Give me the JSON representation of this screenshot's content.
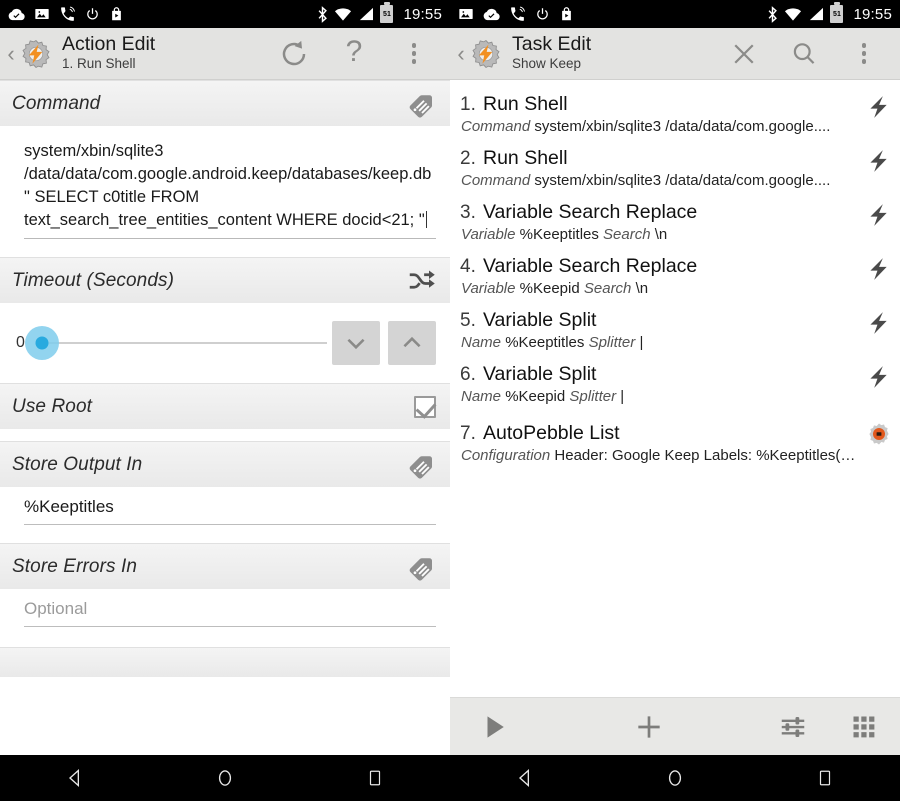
{
  "status_bar": {
    "time": "19:55",
    "battery_level": "51",
    "left_icons": [
      "cloud-check-icon",
      "image-icon",
      "phone-ringing-icon",
      "power-icon",
      "shopping-bag-icon"
    ],
    "right_icons": [
      "bluetooth-icon",
      "wifi-icon",
      "signal-icon",
      "battery-icon"
    ]
  },
  "left_panel": {
    "action_bar": {
      "back_label": "‹",
      "title": "Action Edit",
      "subtitle": "1. Run Shell",
      "logo_name": "tasker-logo-icon",
      "actions": [
        "reset-icon",
        "help-icon",
        "overflow-menu-icon"
      ],
      "help_glyph": "?"
    },
    "sections": {
      "command": {
        "label": "Command",
        "icon": "variable-tag-icon",
        "value": "system/xbin/sqlite3 /data/data/com.google.android.keep/databases/keep.db \" SELECT c0title FROM text_search_tree_entities_content WHERE docid<21; \""
      },
      "timeout": {
        "label": "Timeout (Seconds)",
        "icon": "shuffle-icon",
        "value": "0",
        "decrement_icon": "chevron-down-icon",
        "increment_icon": "chevron-up-icon"
      },
      "use_root": {
        "label": "Use Root",
        "icon": "checkbox-checked-icon",
        "checked": "true"
      },
      "store_output_in": {
        "label": "Store Output In",
        "icon": "variable-tag-icon",
        "value": "%Keeptitles"
      },
      "store_errors_in": {
        "label": "Store Errors In",
        "icon": "variable-tag-icon",
        "value": "",
        "placeholder": "Optional"
      }
    }
  },
  "right_panel": {
    "action_bar": {
      "back_label": "‹",
      "title": "Task Edit",
      "subtitle": "Show Keep",
      "logo_name": "tasker-logo-icon",
      "actions": [
        "close-icon",
        "search-icon",
        "overflow-menu-icon"
      ]
    },
    "actions": [
      {
        "number": "1.",
        "name": "Run Shell",
        "sub_label": "Command",
        "sub_value": "system/xbin/sqlite3 /data/data/com.google....",
        "icon": "lightning-bolt-icon"
      },
      {
        "number": "2.",
        "name": "Run Shell",
        "sub_label": "Command",
        "sub_value": "system/xbin/sqlite3 /data/data/com.google....",
        "icon": "lightning-bolt-icon"
      },
      {
        "number": "3.",
        "name": "Variable Search Replace",
        "sub_label": "Variable",
        "sub_value": "%Keeptitles",
        "sub_label2": "Search",
        "sub_value2": "\\n",
        "icon": "lightning-bolt-icon"
      },
      {
        "number": "4.",
        "name": "Variable Search Replace",
        "sub_label": "Variable",
        "sub_value": "%Keepid",
        "sub_label2": "Search",
        "sub_value2": "\\n",
        "icon": "lightning-bolt-icon"
      },
      {
        "number": "5.",
        "name": "Variable Split",
        "sub_label": "Name",
        "sub_value": "%Keeptitles",
        "sub_label2": "Splitter",
        "sub_value2": "|",
        "icon": "lightning-bolt-icon"
      },
      {
        "number": "6.",
        "name": "Variable Split",
        "sub_label": "Name",
        "sub_value": "%Keepid",
        "sub_label2": "Splitter",
        "sub_value2": "|",
        "icon": "lightning-bolt-icon"
      },
      {
        "number": "7.",
        "name": "AutoPebble List",
        "sub_label": "Configuration",
        "sub_value": "Header: Google Keep Labels: %Keeptitles(…",
        "icon": "autopebble-icon"
      }
    ],
    "bottom_bar": {
      "play_icon": "play-icon",
      "add_icon": "plus-icon",
      "filter_icon": "sliders-icon",
      "grid_icon": "grid-icon"
    }
  },
  "nav_bar": {
    "back_icon": "nav-back-icon",
    "home_icon": "nav-home-icon",
    "recents_icon": "nav-recents-icon"
  },
  "colors": {
    "accent": "#29aadf",
    "accent_halo": "#7fcdec",
    "action_bar_bg": "#e3e3e1",
    "section_header_bg": "#eeeeee",
    "logo_orange": "#f29023"
  }
}
